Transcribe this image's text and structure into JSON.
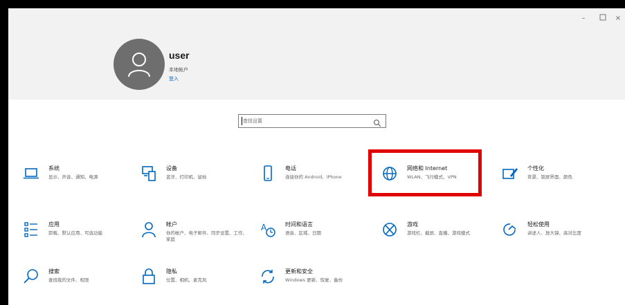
{
  "window": {
    "minimize_icon": "minimize-icon",
    "maximize_icon": "maximize-icon",
    "close_icon": "close-icon"
  },
  "account": {
    "name": "user",
    "type": "本地帐户",
    "signin": "登入"
  },
  "search": {
    "placeholder": "查找设置",
    "icon": "search-icon"
  },
  "tiles": [
    {
      "id": "system",
      "icon": "laptop-icon",
      "title": "系统",
      "desc": "显示、声音、通知、电源"
    },
    {
      "id": "devices",
      "icon": "devices-icon",
      "title": "设备",
      "desc": "蓝牙、打印机、鼠标"
    },
    {
      "id": "phone",
      "icon": "phone-icon",
      "title": "电话",
      "desc": "连接你的 Android、iPhone"
    },
    {
      "id": "network",
      "icon": "globe-icon",
      "title": "网络和 Internet",
      "desc": "WLAN、飞行模式、VPN"
    },
    {
      "id": "personalization",
      "icon": "paintbrush-icon",
      "title": "个性化",
      "desc": "背景、锁屏界面、颜色"
    },
    {
      "id": "apps",
      "icon": "apps-list-icon",
      "title": "应用",
      "desc": "卸载、默认应用、可选功能"
    },
    {
      "id": "accounts",
      "icon": "person-icon",
      "title": "帐户",
      "desc": "你的帐户、电子邮件、同步设置、工作、家庭"
    },
    {
      "id": "time-language",
      "icon": "time-language-icon",
      "title": "时间和语言",
      "desc": "语音、区域、日期"
    },
    {
      "id": "gaming",
      "icon": "xbox-icon",
      "title": "游戏",
      "desc": "游戏栏、截屏、直播、游戏模式"
    },
    {
      "id": "ease-of-access",
      "icon": "ease-of-access-icon",
      "title": "轻松使用",
      "desc": "讲述人、放大镜、高对比度"
    },
    {
      "id": "search",
      "icon": "magnifier-icon",
      "title": "搜索",
      "desc": "查找我的文件、权限"
    },
    {
      "id": "privacy",
      "icon": "lock-icon",
      "title": "隐私",
      "desc": "位置、相机、麦克风"
    },
    {
      "id": "update-security",
      "icon": "sync-icon",
      "title": "更新和安全",
      "desc": "Windows 更新、恢复、备份"
    }
  ],
  "colors": {
    "accent": "#0067c0",
    "highlight": "#e00000",
    "header_bg": "#f2f2f2",
    "avatar_bg": "#6e6e6e"
  }
}
